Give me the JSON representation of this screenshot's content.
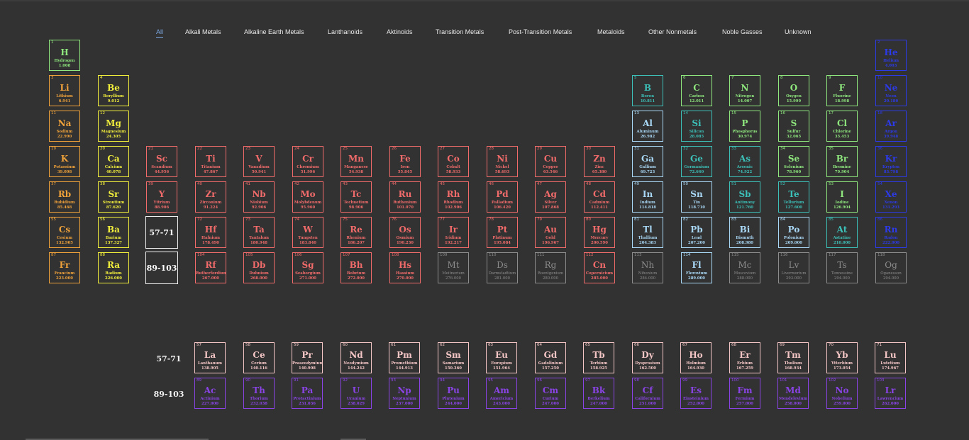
{
  "filters": [
    "All",
    "Alkali Metals",
    "Alkaline Earth Metals",
    "Lanthanoids",
    "Aktinoids",
    "Transition Metals",
    "Post-Transition Metals",
    "Metaloids",
    "Other Nonmetals",
    "Noble Gasses",
    "Unknown"
  ],
  "active_filter": "All",
  "colors": {
    "alkali": "#f0a23a",
    "alkaline": "#f2ee3c",
    "transition": "#f26b6b",
    "post": "#a9d8f6",
    "metalloid": "#3cc0b8",
    "nonmetal": "#8fe87e",
    "noble": "#2c3ae8",
    "lanth": "#f5c6c6",
    "actin": "#8a44e6",
    "unknown": "#8c8c8c"
  },
  "placeholders": {
    "lanthanides": "57-71",
    "actinides": "89-103"
  },
  "row_labels": {
    "lanthanides": "57-71",
    "actinides": "89-103"
  },
  "elements": [
    {
      "n": "1",
      "s": "H",
      "name": "Hydrogen",
      "w": "1.008",
      "cat": "nonmetal"
    },
    {
      "n": "2",
      "s": "He",
      "name": "Helium",
      "w": "4.003",
      "cat": "noble"
    },
    {
      "n": "3",
      "s": "Li",
      "name": "Lithium",
      "w": "6.941",
      "cat": "alkali"
    },
    {
      "n": "4",
      "s": "Be",
      "name": "Beryllium",
      "w": "9.012",
      "cat": "alkaline"
    },
    {
      "n": "5",
      "s": "B",
      "name": "Boron",
      "w": "10.811",
      "cat": "metalloid"
    },
    {
      "n": "6",
      "s": "C",
      "name": "Carbon",
      "w": "12.011",
      "cat": "nonmetal"
    },
    {
      "n": "7",
      "s": "N",
      "name": "Nitrogen",
      "w": "14.007",
      "cat": "nonmetal"
    },
    {
      "n": "8",
      "s": "O",
      "name": "Oxygen",
      "w": "15.999",
      "cat": "nonmetal"
    },
    {
      "n": "9",
      "s": "F",
      "name": "Fluorine",
      "w": "18.998",
      "cat": "nonmetal"
    },
    {
      "n": "10",
      "s": "Ne",
      "name": "Neon",
      "w": "20.180",
      "cat": "noble"
    },
    {
      "n": "11",
      "s": "Na",
      "name": "Sodium",
      "w": "22.990",
      "cat": "alkali"
    },
    {
      "n": "12",
      "s": "Mg",
      "name": "Magnesium",
      "w": "24.305",
      "cat": "alkaline"
    },
    {
      "n": "13",
      "s": "Al",
      "name": "Aluminum",
      "w": "26.982",
      "cat": "post"
    },
    {
      "n": "14",
      "s": "Si",
      "name": "Silicon",
      "w": "28.085",
      "cat": "metalloid"
    },
    {
      "n": "15",
      "s": "P",
      "name": "Phosphorus",
      "w": "30.974",
      "cat": "nonmetal"
    },
    {
      "n": "16",
      "s": "S",
      "name": "Sulfur",
      "w": "32.065",
      "cat": "nonmetal"
    },
    {
      "n": "17",
      "s": "Cl",
      "name": "Chlorine",
      "w": "35.453",
      "cat": "nonmetal"
    },
    {
      "n": "18",
      "s": "Ar",
      "name": "Argon",
      "w": "39.948",
      "cat": "noble"
    },
    {
      "n": "19",
      "s": "K",
      "name": "Potassium",
      "w": "39.098",
      "cat": "alkali"
    },
    {
      "n": "20",
      "s": "Ca",
      "name": "Calcium",
      "w": "40.078",
      "cat": "alkaline"
    },
    {
      "n": "21",
      "s": "Sc",
      "name": "Scandium",
      "w": "44.956",
      "cat": "transition"
    },
    {
      "n": "22",
      "s": "Ti",
      "name": "Titanium",
      "w": "47.867",
      "cat": "transition"
    },
    {
      "n": "23",
      "s": "V",
      "name": "Vanadium",
      "w": "50.941",
      "cat": "transition"
    },
    {
      "n": "24",
      "s": "Cr",
      "name": "Chromium",
      "w": "51.996",
      "cat": "transition"
    },
    {
      "n": "25",
      "s": "Mn",
      "name": "Manganese",
      "w": "54.938",
      "cat": "transition"
    },
    {
      "n": "26",
      "s": "Fe",
      "name": "Iron",
      "w": "55.845",
      "cat": "transition"
    },
    {
      "n": "27",
      "s": "Co",
      "name": "Cobalt",
      "w": "58.933",
      "cat": "transition"
    },
    {
      "n": "28",
      "s": "Ni",
      "name": "Nickel",
      "w": "58.693",
      "cat": "transition"
    },
    {
      "n": "29",
      "s": "Cu",
      "name": "Copper",
      "w": "63.546",
      "cat": "transition"
    },
    {
      "n": "30",
      "s": "Zn",
      "name": "Zinc",
      "w": "65.380",
      "cat": "transition"
    },
    {
      "n": "31",
      "s": "Ga",
      "name": "Gallium",
      "w": "69.723",
      "cat": "post"
    },
    {
      "n": "32",
      "s": "Ge",
      "name": "Germanium",
      "w": "72.640",
      "cat": "metalloid"
    },
    {
      "n": "33",
      "s": "As",
      "name": "Arsenic",
      "w": "74.922",
      "cat": "metalloid"
    },
    {
      "n": "34",
      "s": "Se",
      "name": "Selenium",
      "w": "78.960",
      "cat": "nonmetal"
    },
    {
      "n": "35",
      "s": "Br",
      "name": "Bromine",
      "w": "79.904",
      "cat": "nonmetal"
    },
    {
      "n": "36",
      "s": "Kr",
      "name": "Krypton",
      "w": "83.798",
      "cat": "noble"
    },
    {
      "n": "37",
      "s": "Rb",
      "name": "Rubidium",
      "w": "85.468",
      "cat": "alkali"
    },
    {
      "n": "38",
      "s": "Sr",
      "name": "Strontium",
      "w": "87.620",
      "cat": "alkaline"
    },
    {
      "n": "39",
      "s": "Y",
      "name": "Yttrium",
      "w": "88.906",
      "cat": "transition"
    },
    {
      "n": "40",
      "s": "Zr",
      "name": "Zirconium",
      "w": "91.224",
      "cat": "transition"
    },
    {
      "n": "41",
      "s": "Nb",
      "name": "Niobium",
      "w": "92.906",
      "cat": "transition"
    },
    {
      "n": "42",
      "s": "Mo",
      "name": "Molybdenum",
      "w": "95.960",
      "cat": "transition"
    },
    {
      "n": "43",
      "s": "Tc",
      "name": "Technetium",
      "w": "98.906",
      "cat": "transition"
    },
    {
      "n": "44",
      "s": "Ru",
      "name": "Ruthenium",
      "w": "101.070",
      "cat": "transition"
    },
    {
      "n": "45",
      "s": "Rh",
      "name": "Rhodium",
      "w": "102.906",
      "cat": "transition"
    },
    {
      "n": "46",
      "s": "Pd",
      "name": "Palladium",
      "w": "106.420",
      "cat": "transition"
    },
    {
      "n": "47",
      "s": "Ag",
      "name": "Silver",
      "w": "107.868",
      "cat": "transition"
    },
    {
      "n": "48",
      "s": "Cd",
      "name": "Cadmium",
      "w": "112.411",
      "cat": "transition"
    },
    {
      "n": "49",
      "s": "In",
      "name": "Indium",
      "w": "114.818",
      "cat": "post"
    },
    {
      "n": "50",
      "s": "Sn",
      "name": "Tin",
      "w": "118.710",
      "cat": "post"
    },
    {
      "n": "51",
      "s": "Sb",
      "name": "Antimony",
      "w": "121.760",
      "cat": "metalloid"
    },
    {
      "n": "52",
      "s": "Te",
      "name": "Tellurium",
      "w": "127.600",
      "cat": "metalloid"
    },
    {
      "n": "53",
      "s": "I",
      "name": "Iodine",
      "w": "126.904",
      "cat": "nonmetal"
    },
    {
      "n": "54",
      "s": "Xe",
      "name": "Xenon",
      "w": "131.293",
      "cat": "noble"
    },
    {
      "n": "55",
      "s": "Cs",
      "name": "Cesium",
      "w": "132.905",
      "cat": "alkali"
    },
    {
      "n": "56",
      "s": "Ba",
      "name": "Barium",
      "w": "137.327",
      "cat": "alkaline"
    },
    {
      "n": "72",
      "s": "Hf",
      "name": "Hafnium",
      "w": "178.490",
      "cat": "transition"
    },
    {
      "n": "73",
      "s": "Ta",
      "name": "Tantalum",
      "w": "180.948",
      "cat": "transition"
    },
    {
      "n": "74",
      "s": "W",
      "name": "Tungsten",
      "w": "183.840",
      "cat": "transition"
    },
    {
      "n": "75",
      "s": "Re",
      "name": "Rhenium",
      "w": "186.207",
      "cat": "transition"
    },
    {
      "n": "76",
      "s": "Os",
      "name": "Osmium",
      "w": "190.230",
      "cat": "transition"
    },
    {
      "n": "77",
      "s": "Ir",
      "name": "Iridium",
      "w": "192.217",
      "cat": "transition"
    },
    {
      "n": "78",
      "s": "Pt",
      "name": "Platinum",
      "w": "195.084",
      "cat": "transition"
    },
    {
      "n": "79",
      "s": "Au",
      "name": "Gold",
      "w": "196.967",
      "cat": "transition"
    },
    {
      "n": "80",
      "s": "Hg",
      "name": "Mercury",
      "w": "200.590",
      "cat": "transition"
    },
    {
      "n": "81",
      "s": "Tl",
      "name": "Thallium",
      "w": "204.383",
      "cat": "post"
    },
    {
      "n": "82",
      "s": "Pb",
      "name": "Lead",
      "w": "207.200",
      "cat": "post"
    },
    {
      "n": "83",
      "s": "Bi",
      "name": "Bismuth",
      "w": "208.980",
      "cat": "post"
    },
    {
      "n": "84",
      "s": "Po",
      "name": "Polonium",
      "w": "209.000",
      "cat": "post"
    },
    {
      "n": "85",
      "s": "At",
      "name": "Astatine",
      "w": "210.000",
      "cat": "metalloid"
    },
    {
      "n": "86",
      "s": "Rn",
      "name": "Radon",
      "w": "222.000",
      "cat": "noble"
    },
    {
      "n": "87",
      "s": "Fr",
      "name": "Francium",
      "w": "223.000",
      "cat": "alkali"
    },
    {
      "n": "88",
      "s": "Ra",
      "name": "Radium",
      "w": "226.000",
      "cat": "alkaline"
    },
    {
      "n": "104",
      "s": "Rf",
      "name": "Rutherfordium",
      "w": "267.000",
      "cat": "transition"
    },
    {
      "n": "105",
      "s": "Db",
      "name": "Dubnium",
      "w": "268.000",
      "cat": "transition"
    },
    {
      "n": "106",
      "s": "Sg",
      "name": "Seaborgium",
      "w": "271.000",
      "cat": "transition"
    },
    {
      "n": "107",
      "s": "Bh",
      "name": "Bohrium",
      "w": "272.000",
      "cat": "transition"
    },
    {
      "n": "108",
      "s": "Hs",
      "name": "Hassium",
      "w": "270.000",
      "cat": "transition"
    },
    {
      "n": "109",
      "s": "Mt",
      "name": "Meitnerium",
      "w": "276.000",
      "cat": "unknown"
    },
    {
      "n": "110",
      "s": "Ds",
      "name": "Darmstadtium",
      "w": "281.000",
      "cat": "unknown"
    },
    {
      "n": "111",
      "s": "Rg",
      "name": "Roentgenium",
      "w": "280.000",
      "cat": "unknown"
    },
    {
      "n": "112",
      "s": "Cn",
      "name": "Copernicium",
      "w": "285.000",
      "cat": "transition"
    },
    {
      "n": "113",
      "s": "Nh",
      "name": "Nihonium",
      "w": "284.000",
      "cat": "unknown"
    },
    {
      "n": "114",
      "s": "Fl",
      "name": "Flerovium",
      "w": "289.000",
      "cat": "post"
    },
    {
      "n": "115",
      "s": "Mc",
      "name": "Moscovium",
      "w": "288.000",
      "cat": "unknown"
    },
    {
      "n": "116",
      "s": "Lv",
      "name": "Livermorium",
      "w": "293.000",
      "cat": "unknown"
    },
    {
      "n": "117",
      "s": "Ts",
      "name": "Tennessine",
      "w": "294.000",
      "cat": "unknown"
    },
    {
      "n": "118",
      "s": "Og",
      "name": "Oganesson",
      "w": "294.000",
      "cat": "unknown"
    },
    {
      "n": "57",
      "s": "La",
      "name": "Lanthanum",
      "w": "138.905",
      "cat": "lanth"
    },
    {
      "n": "58",
      "s": "Ce",
      "name": "Cerium",
      "w": "140.116",
      "cat": "lanth"
    },
    {
      "n": "59",
      "s": "Pr",
      "name": "Praseodymium",
      "w": "140.908",
      "cat": "lanth"
    },
    {
      "n": "60",
      "s": "Nd",
      "name": "Neodymium",
      "w": "144.242",
      "cat": "lanth"
    },
    {
      "n": "61",
      "s": "Pm",
      "name": "Promethium",
      "w": "144.913",
      "cat": "lanth"
    },
    {
      "n": "62",
      "s": "Sm",
      "name": "Samarium",
      "w": "150.360",
      "cat": "lanth"
    },
    {
      "n": "63",
      "s": "Eu",
      "name": "Europium",
      "w": "151.964",
      "cat": "lanth"
    },
    {
      "n": "64",
      "s": "Gd",
      "name": "Gadolinium",
      "w": "157.250",
      "cat": "lanth"
    },
    {
      "n": "65",
      "s": "Tb",
      "name": "Terbium",
      "w": "158.925",
      "cat": "lanth"
    },
    {
      "n": "66",
      "s": "Dy",
      "name": "Dysprosium",
      "w": "162.500",
      "cat": "lanth"
    },
    {
      "n": "67",
      "s": "Ho",
      "name": "Holmium",
      "w": "164.930",
      "cat": "lanth"
    },
    {
      "n": "68",
      "s": "Er",
      "name": "Erbium",
      "w": "167.259",
      "cat": "lanth"
    },
    {
      "n": "69",
      "s": "Tm",
      "name": "Thulium",
      "w": "168.934",
      "cat": "lanth"
    },
    {
      "n": "70",
      "s": "Yb",
      "name": "Ytterbium",
      "w": "173.054",
      "cat": "lanth"
    },
    {
      "n": "71",
      "s": "Lu",
      "name": "Lutetium",
      "w": "174.967",
      "cat": "lanth"
    },
    {
      "n": "89",
      "s": "Ac",
      "name": "Actinium",
      "w": "227.000",
      "cat": "actin"
    },
    {
      "n": "90",
      "s": "Th",
      "name": "Thorium",
      "w": "232.038",
      "cat": "actin"
    },
    {
      "n": "91",
      "s": "Pa",
      "name": "Protactinium",
      "w": "231.036",
      "cat": "actin"
    },
    {
      "n": "92",
      "s": "U",
      "name": "Uranium",
      "w": "238.029",
      "cat": "actin"
    },
    {
      "n": "93",
      "s": "Np",
      "name": "Neptunium",
      "w": "237.000",
      "cat": "actin"
    },
    {
      "n": "94",
      "s": "Pu",
      "name": "Plutonium",
      "w": "244.000",
      "cat": "actin"
    },
    {
      "n": "95",
      "s": "Am",
      "name": "Americium",
      "w": "243.000",
      "cat": "actin"
    },
    {
      "n": "96",
      "s": "Cm",
      "name": "Curium",
      "w": "247.000",
      "cat": "actin"
    },
    {
      "n": "97",
      "s": "Bk",
      "name": "Berkelium",
      "w": "247.000",
      "cat": "actin"
    },
    {
      "n": "98",
      "s": "Cf",
      "name": "Californium",
      "w": "251.000",
      "cat": "actin"
    },
    {
      "n": "99",
      "s": "Es",
      "name": "Einsteinium",
      "w": "252.000",
      "cat": "actin"
    },
    {
      "n": "100",
      "s": "Fm",
      "name": "Fermium",
      "w": "257.000",
      "cat": "actin"
    },
    {
      "n": "101",
      "s": "Md",
      "name": "Mendelevium",
      "w": "258.000",
      "cat": "actin"
    },
    {
      "n": "102",
      "s": "No",
      "name": "Nobelium",
      "w": "259.000",
      "cat": "actin"
    },
    {
      "n": "103",
      "s": "Lr",
      "name": "Lawrencium",
      "w": "262.000",
      "cat": "actin"
    }
  ]
}
